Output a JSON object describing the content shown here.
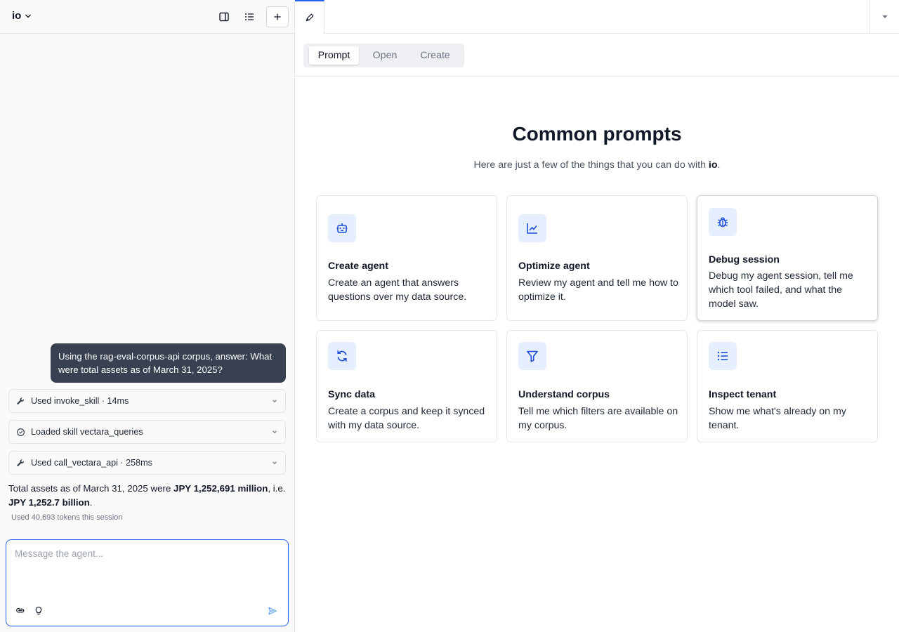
{
  "sidebar": {
    "app_name": "io",
    "user_message": "Using the rag-eval-corpus-api corpus, answer: What were total assets as of March 31, 2025?",
    "tool_steps": [
      {
        "label": "Used invoke_skill · 14ms",
        "icon": "wrench-icon"
      },
      {
        "label": "Loaded skill vectara_queries",
        "icon": "skill-icon"
      },
      {
        "label": "Used call_vectara_api · 258ms",
        "icon": "wrench-icon"
      }
    ],
    "answer": {
      "prefix": "Total assets as of March 31, 2025 were ",
      "bold1": "JPY 1,252,691 million",
      "middle": ", i.e. ",
      "bold2": "JPY 1,252.7 billion",
      "suffix": "."
    },
    "token_note": "Used 40,693 tokens this session",
    "composer": {
      "placeholder": "Message the agent..."
    }
  },
  "main": {
    "segmented": {
      "items": [
        "Prompt",
        "Open",
        "Create"
      ],
      "active": "Prompt"
    },
    "heading": "Common prompts",
    "subheading_prefix": "Here are just a few of the things that you can do with ",
    "subheading_bold": "io",
    "subheading_suffix": ".",
    "cards": [
      {
        "title": "Create agent",
        "desc": "Create an agent that answers questions over my data source.",
        "icon": "robot-icon"
      },
      {
        "title": "Optimize agent",
        "desc": "Review my agent and tell me how to optimize it.",
        "icon": "chart-line-icon"
      },
      {
        "title": "Debug session",
        "desc": "Debug my agent session, tell me which tool failed, and what the model saw.",
        "icon": "bug-icon"
      },
      {
        "title": "Sync data",
        "desc": "Create a corpus and keep it synced with my data source.",
        "icon": "sync-icon"
      },
      {
        "title": "Understand corpus",
        "desc": "Tell me which filters are available on my corpus.",
        "icon": "filter-icon"
      },
      {
        "title": "Inspect tenant",
        "desc": "Show me what's already on my tenant.",
        "icon": "list-icon"
      }
    ]
  },
  "colors": {
    "accent": "#2563eb",
    "icon_bg": "#e6effd",
    "icon_fg": "#1d4ed8",
    "user_bubble": "#374151"
  }
}
